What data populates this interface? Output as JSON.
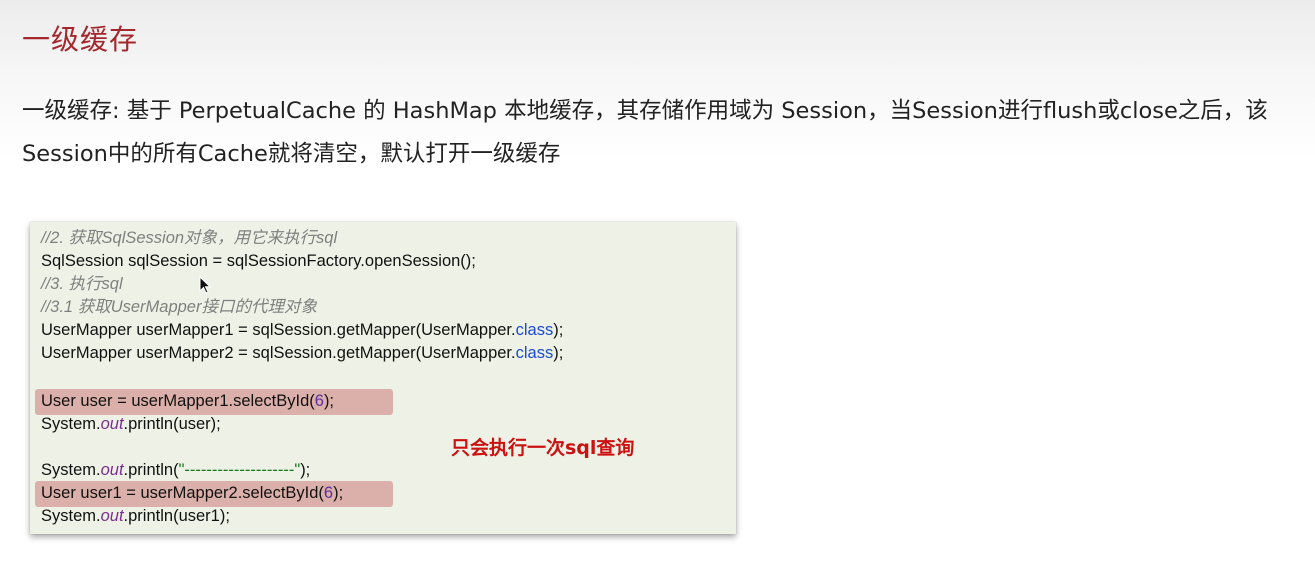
{
  "title": "一级缓存",
  "description": "一级缓存: 基于 PerpetualCache 的 HashMap 本地缓存，其存储作用域为 Session，当Session进行flush或close之后，该Session中的所有Cache就将清空，默认打开一级缓存",
  "code": {
    "line1": "//2. 获取SqlSession对象，用它来执行sql",
    "line2": "SqlSession sqlSession = sqlSessionFactory.openSession();",
    "line3": "//3. 执行sql",
    "line4": "//3.1 获取UserMapper接口的代理对象",
    "line5_pre": "UserMapper userMapper1 = sqlSession.getMapper(UserMapper.",
    "line5_kw": "class",
    "line5_post": ");",
    "line6_pre": "UserMapper userMapper2 = sqlSession.getMapper(UserMapper.",
    "line6_kw": "class",
    "line6_post": ");",
    "line7_pre": "User user = userMapper1.selectById(",
    "line7_num": "6",
    "line7_post": ");",
    "line8_pre": "System.",
    "line8_field": "out",
    "line8_post": ".println(user);",
    "line9_pre": "System.",
    "line9_field": "out",
    "line9_mid": ".println(",
    "line9_str": "\"--------------------\"",
    "line9_post": ");",
    "line10_pre": "User user1 = userMapper2.selectById(",
    "line10_num": "6",
    "line10_post": ");",
    "line11_pre": "System.",
    "line11_field": "out",
    "line11_post": ".println(user1);"
  },
  "note": "只会执行一次sql查询",
  "colors": {
    "title": "#a4272d",
    "note": "#cc1111",
    "highlight": "#d9a9a3",
    "code_background": "#eef2e6"
  }
}
